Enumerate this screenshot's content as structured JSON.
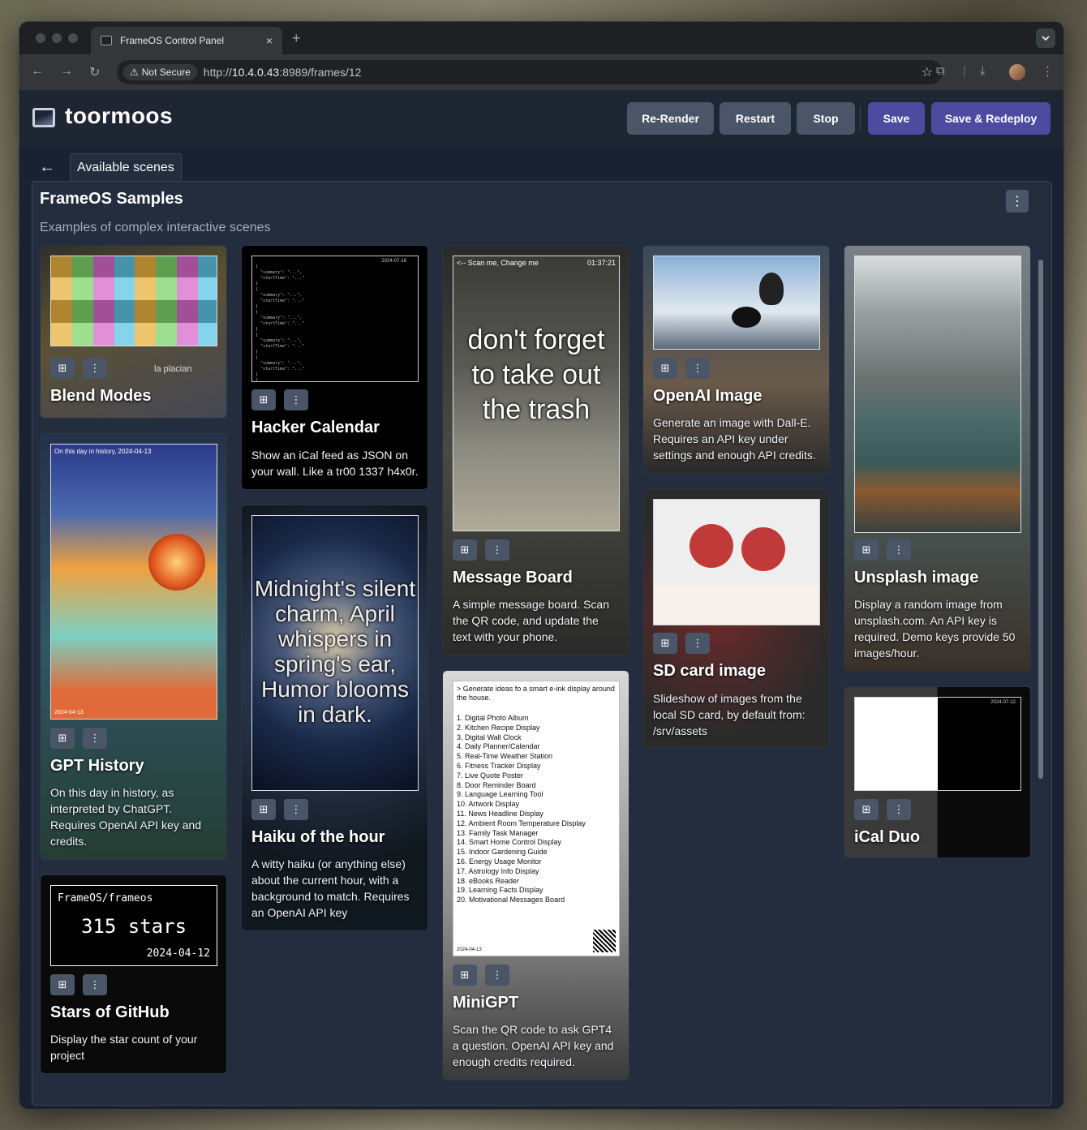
{
  "browser": {
    "tab_title": "FrameOS Control Panel",
    "tab_close": "×",
    "new_tab": "+",
    "not_secure": "Not Secure",
    "url_host": "10.4.0.43",
    "url_prefix": "http://",
    "url_path": ":8989/frames/12"
  },
  "app": {
    "brand": "toormoos",
    "buttons": {
      "rerender": "Re-Render",
      "restart": "Restart",
      "stop": "Stop",
      "save": "Save",
      "save_redeploy": "Save & Redeploy"
    }
  },
  "scenes_tab": "Available scenes",
  "panel": {
    "title": "FrameOS Samples",
    "subtitle": "Examples of complex interactive scenes"
  },
  "cards": {
    "blend": {
      "title": "Blend Modes",
      "caption": "la placian"
    },
    "hacker": {
      "title": "Hacker Calendar",
      "desc": "Show an iCal feed as JSON on your wall. Like a tr00 1337 h4x0r.",
      "date": "2024-07-16"
    },
    "message": {
      "title": "Message Board",
      "desc": "A simple message board. Scan the QR code, and update the text with your phone.",
      "header_left": "<-- Scan me, Change me",
      "header_right": "01:37:21",
      "text": "don't forget to take out the trash"
    },
    "openai": {
      "title": "OpenAI Image",
      "desc": "Generate an image with Dall-E. Requires an API key under settings and enough API credits."
    },
    "unsplash": {
      "title": "Unsplash image",
      "desc": "Display a random image from unsplash.com. An API key is required. Demo keys provide 50 images/hour."
    },
    "gpt": {
      "title": "GPT History",
      "desc": "On this day in history, as interpreted by ChatGPT. Requires OpenAI API key and credits.",
      "header": "On this day in history, 2024-04-13",
      "footer": "2024-04-13"
    },
    "haiku": {
      "title": "Haiku of the hour",
      "desc": "A witty haiku (or anything else) about the current hour, with a background to match. Requires an OpenAI API key",
      "text": "Midnight's silent charm, April whispers in spring's ear, Humor blooms in dark."
    },
    "sdcard": {
      "title": "SD card image",
      "desc": "Slideshow of images from the local SD card, by default from: /srv/assets"
    },
    "ical": {
      "title": "iCal Duo",
      "date": "2024-07-12"
    },
    "stars": {
      "title": "Stars of GitHub",
      "desc": "Display the star count of your project",
      "repo": "FrameOS/frameos",
      "count": "315 stars",
      "date": "2024-04-12"
    },
    "minigpt": {
      "title": "MiniGPT",
      "desc": "Scan the QR code to ask GPT4 a question. OpenAI API key and enough credits required.",
      "prompt": "> Generate ideas fo a smart e-ink display around the house.",
      "items": [
        "1. Digital Photo Album",
        "2. Kitchen Recipe Display",
        "3. Digital Wall Clock",
        "4. Daily Planner/Calendar",
        "5. Real-Time Weather Station",
        "6. Fitness Tracker Display",
        "7. Live Quote Poster",
        "8. Door Reminder Board",
        "9. Language Learning Tool",
        "10. Artwork Display",
        "11. News Headline Display",
        "12. Ambient Room Temperature Display",
        "13. Family Task Manager",
        "14. Smart Home Control Display",
        "15. Indoor Gardening Guide",
        "16. Energy Usage Monitor",
        "17. Astrology Info Display",
        "18. eBooks Reader",
        "19. Learning Facts Display",
        "20. Motivational Messages Board"
      ],
      "date": "2024-04-13"
    }
  }
}
